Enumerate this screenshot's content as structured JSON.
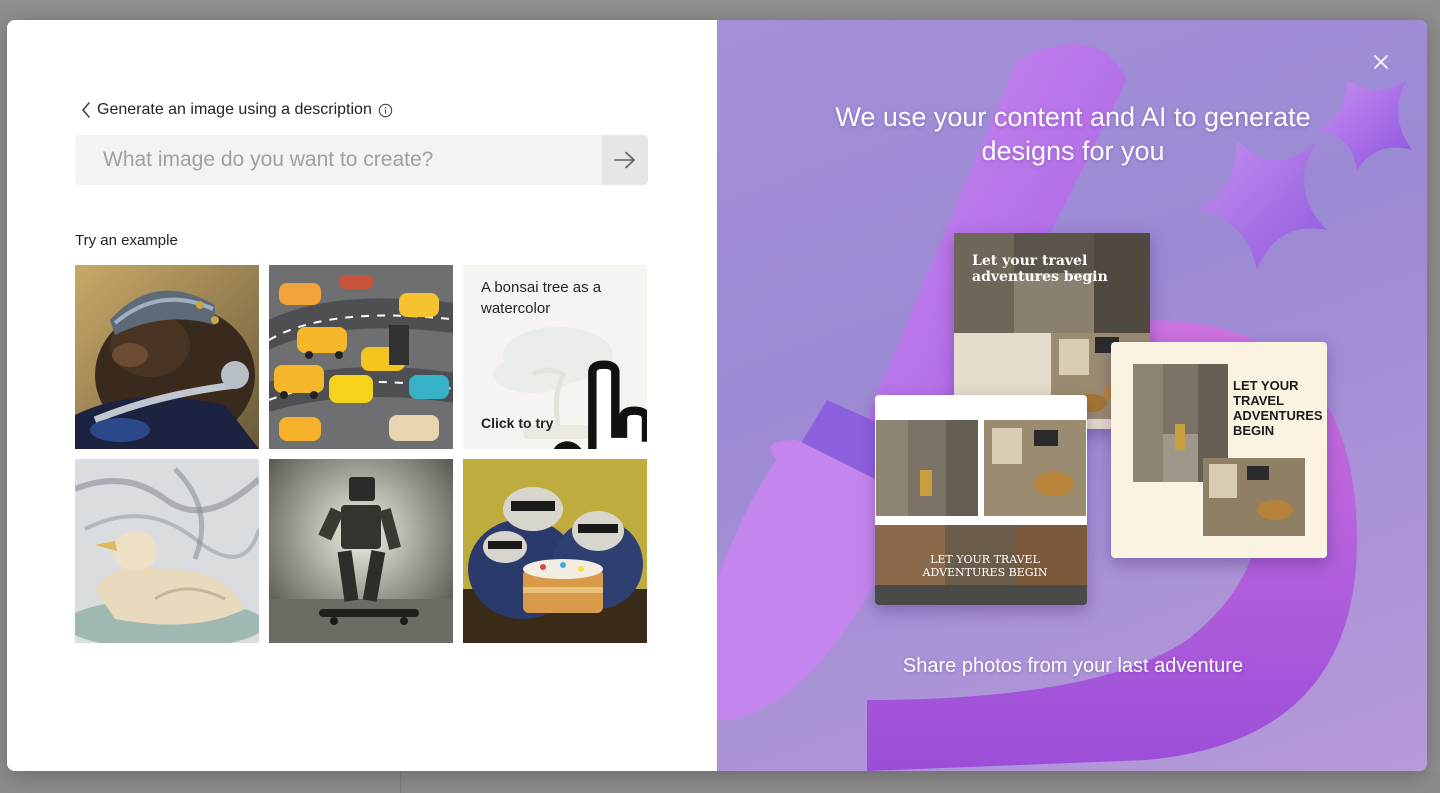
{
  "header": {
    "title": "Generate an image using a description"
  },
  "prompt": {
    "placeholder": "What image do you want to create?",
    "value": ""
  },
  "examples": {
    "label": "Try an example",
    "hover_tile": {
      "caption": "A bonsai tree as a watercolor",
      "cta": "Click to try"
    }
  },
  "promo": {
    "title": "We use your content and AI to generate designs for you",
    "caption": "Share photos from your last adventure",
    "card_a_title": "Let your travel adventures begin",
    "card_b_title": "LET YOUR TRAVEL ADVENTURES BEGIN",
    "card_c_title": "LET YOUR TRAVEL ADVENTURES BEGIN"
  },
  "colors": {
    "accent_purple": "#b36ee8",
    "panel_bg": "#a48fd8"
  }
}
